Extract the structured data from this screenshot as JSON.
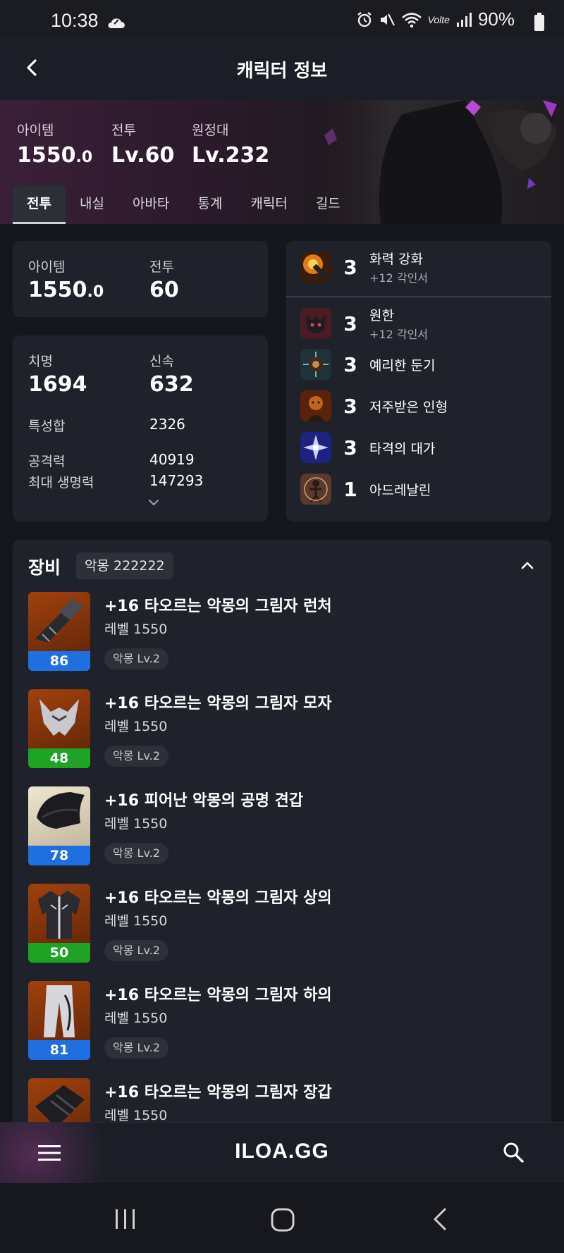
{
  "status_bar": {
    "time": "10:38",
    "battery": "90%",
    "network": "Volte"
  },
  "app_bar": {
    "title": "캐릭터 정보"
  },
  "hero": {
    "stats": [
      {
        "label": "아이템",
        "value": "1550",
        "decimal": ".0"
      },
      {
        "label": "전투",
        "value": "Lv.60",
        "decimal": ""
      },
      {
        "label": "원정대",
        "value": "Lv.232",
        "decimal": ""
      }
    ],
    "tabs": [
      "전투",
      "내실",
      "아바타",
      "통계",
      "캐릭터",
      "길드"
    ],
    "active_tab": "전투"
  },
  "summary_card": {
    "item_label": "아이템",
    "item_value": "1550",
    "item_decimal": ".0",
    "combat_label": "전투",
    "combat_value": "60"
  },
  "stats_card": {
    "crit_label": "치명",
    "crit_value": "1694",
    "swift_label": "신속",
    "swift_value": "632",
    "trait_label": "특성합",
    "trait_value": "2326",
    "atk_label": "공격력",
    "atk_value": "40919",
    "hp_label": "최대 생명력",
    "hp_value": "147293"
  },
  "engravings": [
    {
      "level": "3",
      "name": "화력 강화",
      "sub": "+12 각인서",
      "icon": "fire-cannon-icon",
      "color": "#c7561a"
    },
    {
      "level": "3",
      "name": "원한",
      "sub": "+12 각인서",
      "icon": "demon-face-icon",
      "color": "#7a2b34"
    },
    {
      "level": "3",
      "name": "예리한 둔기",
      "sub": "",
      "icon": "spiked-ball-icon",
      "color": "#3d5a66"
    },
    {
      "level": "3",
      "name": "저주받은 인형",
      "sub": "",
      "icon": "cursed-doll-icon",
      "color": "#8a3a14"
    },
    {
      "level": "3",
      "name": "타격의 대가",
      "sub": "",
      "icon": "impact-burst-icon",
      "color": "#3b46c8"
    },
    {
      "level": "1",
      "name": "아드레날린",
      "sub": "",
      "icon": "adrenaline-icon",
      "color": "#6b4a3a"
    }
  ],
  "equipment": {
    "title": "장비",
    "badge": "악몽 222222",
    "items": [
      {
        "name": "+16 타오르는 악몽의 그림자 런처",
        "level": "레벨 1550",
        "tag": "악몽 Lv.2",
        "quality": "86",
        "quality_color": "#1f6fe0",
        "icon": "launcher-icon"
      },
      {
        "name": "+16 타오르는 악몽의 그림자 모자",
        "level": "레벨 1550",
        "tag": "악몽 Lv.2",
        "quality": "48",
        "quality_color": "#1fa325",
        "icon": "helmet-icon"
      },
      {
        "name": "+16 피어난 악몽의 공명 견갑",
        "level": "레벨 1550",
        "tag": "악몽 Lv.2",
        "quality": "78",
        "quality_color": "#1f6fe0",
        "icon": "shoulder-icon"
      },
      {
        "name": "+16 타오르는 악몽의 그림자 상의",
        "level": "레벨 1550",
        "tag": "악몽 Lv.2",
        "quality": "50",
        "quality_color": "#1fa325",
        "icon": "chest-armor-icon"
      },
      {
        "name": "+16 타오르는 악몽의 그림자 하의",
        "level": "레벨 1550",
        "tag": "악몽 Lv.2",
        "quality": "81",
        "quality_color": "#1f6fe0",
        "icon": "pants-icon"
      },
      {
        "name": "+16 타오르는 악몽의 그림자 장갑",
        "level": "레벨 1550",
        "tag": "",
        "quality": "",
        "quality_color": "",
        "icon": "gloves-icon"
      }
    ]
  },
  "bottom_bar": {
    "logo": "ILOA.GG"
  }
}
